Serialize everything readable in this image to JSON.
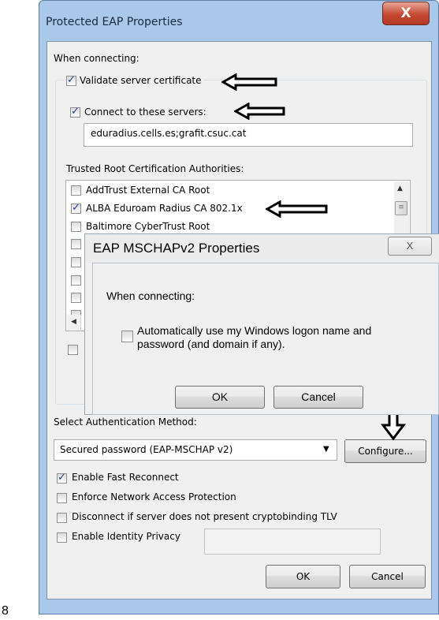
{
  "outer_dialog": {
    "title": "Protected EAP Properties",
    "close_glyph": "X",
    "when_connecting_label": "When connecting:",
    "validate_server_certificate": {
      "label": "Validate server certificate",
      "checked": true
    },
    "connect_to_servers": {
      "label": "Connect to these servers:",
      "checked": true
    },
    "servers_value": "eduradius.cells.es;grafit.csuc.cat",
    "trusted_root_label": "Trusted Root Certification Authorities:",
    "ca_list": [
      {
        "label": "AddTrust External CA Root",
        "checked": false
      },
      {
        "label": "ALBA Eduroam Radius CA 802.1x",
        "checked": true
      },
      {
        "label": "Baltimore CyberTrust Root",
        "checked": false
      }
    ],
    "select_auth_label": "Select Authentication Method:",
    "auth_method_value": "Secured password (EAP-MSCHAP v2)",
    "configure_button": "Configure...",
    "options": [
      {
        "label": "Enable Fast Reconnect",
        "checked": true
      },
      {
        "label": "Enforce Network Access Protection",
        "checked": false
      },
      {
        "label": "Disconnect if server does not present cryptobinding TLV",
        "checked": false
      },
      {
        "label": "Enable Identity Privacy",
        "checked": false
      }
    ],
    "ok_button": "OK",
    "cancel_button": "Cancel"
  },
  "inner_dialog": {
    "title": "EAP MSCHAPv2 Properties",
    "close_glyph": "X",
    "when_connecting_label": "When connecting:",
    "auto_logon": {
      "label_line1": "Automatically use my Windows logon name and",
      "label_line2": "password (and domain if any).",
      "checked": false
    },
    "ok_button": "OK",
    "cancel_button": "Cancel"
  },
  "page_number": "8",
  "colors": {
    "frame": "#a9c8ea",
    "close_button": "#c54a33",
    "dialog_background": "#f0f0f0",
    "annotation_arrow": "#000000"
  },
  "icons": [
    "close-icon",
    "dropdown-arrow-icon",
    "scroll-up-icon",
    "scroll-down-icon",
    "scroll-left-icon",
    "annotation-arrow-left-icon",
    "annotation-arrow-down-icon"
  ]
}
